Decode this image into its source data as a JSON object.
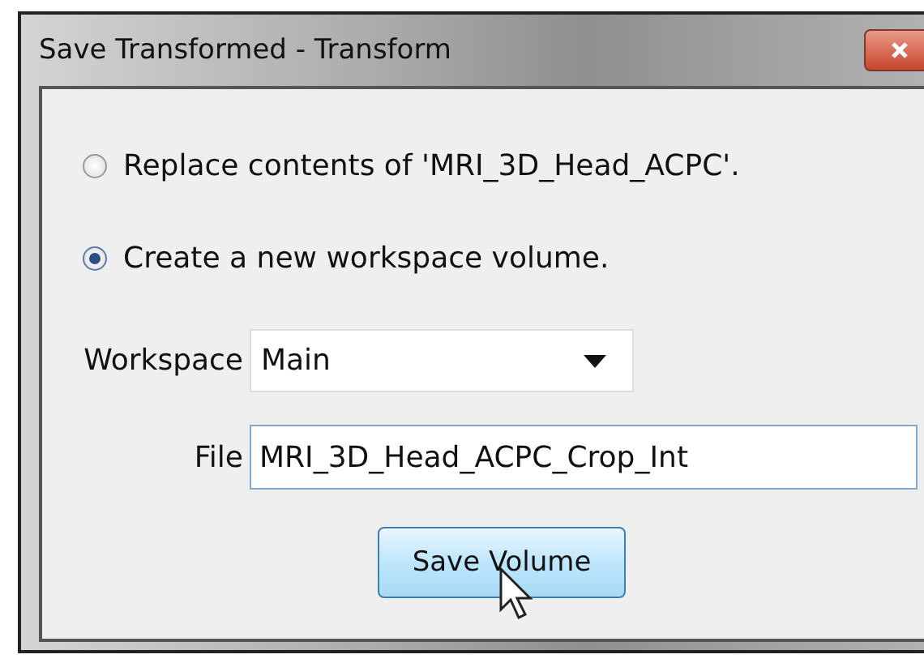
{
  "window": {
    "title": "Save Transformed - Transform"
  },
  "options": [
    {
      "label": "Replace contents of 'MRI_3D_Head_ACPC'.",
      "selected": false
    },
    {
      "label": "Create a new workspace volume.",
      "selected": true
    }
  ],
  "workspace": {
    "label": "Workspace",
    "value": "Main"
  },
  "file": {
    "label": "File",
    "value": "MRI_3D_Head_ACPC_Crop_Int"
  },
  "buttons": [
    "Save Volume"
  ]
}
